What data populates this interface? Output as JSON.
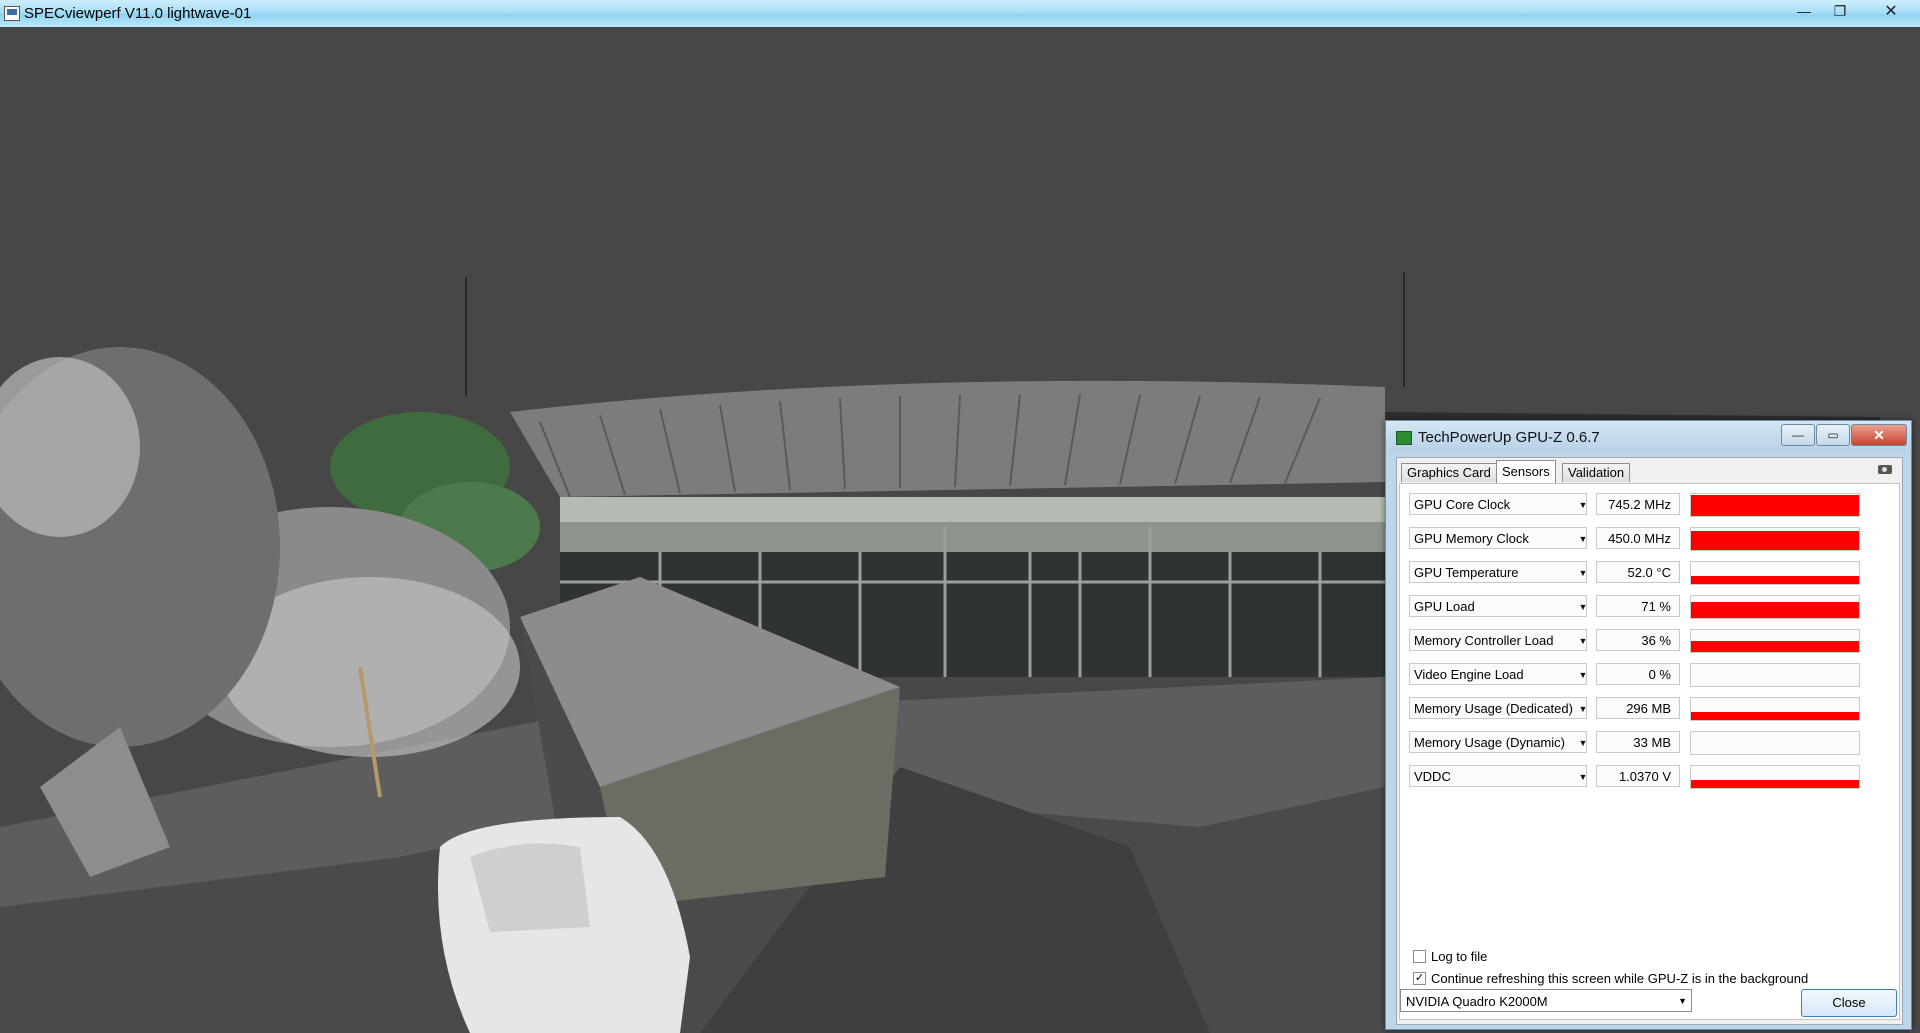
{
  "main_window": {
    "title": "SPECviewperf V11.0 lightwave-01",
    "controls": {
      "minimize": "—",
      "maximize": "❐",
      "close": "✕"
    }
  },
  "gpuz": {
    "title": "TechPowerUp GPU-Z 0.6.7",
    "controls": {
      "minimize": "—",
      "maximize": "▭",
      "close": "✕"
    },
    "tabs": [
      "Graphics Card",
      "Sensors",
      "Validation"
    ],
    "active_tab": "Sensors",
    "sensors": [
      {
        "name": "GPU Core Clock",
        "value": "745.2 MHz",
        "level": 0.95
      },
      {
        "name": "GPU Memory Clock",
        "value": "450.0 MHz",
        "level": 0.85
      },
      {
        "name": "GPU Temperature",
        "value": "52.0 °C",
        "level": 0.35
      },
      {
        "name": "GPU Load",
        "value": "71 %",
        "level": 0.71
      },
      {
        "name": "Memory Controller Load",
        "value": "36 %",
        "level": 0.5
      },
      {
        "name": "Video Engine Load",
        "value": "0 %",
        "level": 0
      },
      {
        "name": "Memory Usage (Dedicated)",
        "value": "296 MB",
        "level": 0.35
      },
      {
        "name": "Memory Usage (Dynamic)",
        "value": "33 MB",
        "level": 0
      },
      {
        "name": "VDDC",
        "value": "1.0370 V",
        "level": 0.35
      }
    ],
    "log_to_file": {
      "label": "Log to file",
      "checked": false
    },
    "continue_refresh": {
      "label": "Continue refreshing this screen while GPU-Z is in the background",
      "checked": true
    },
    "gpu_select": "NVIDIA Quadro K2000M",
    "close_label": "Close",
    "accent_color": "#ff0000"
  }
}
